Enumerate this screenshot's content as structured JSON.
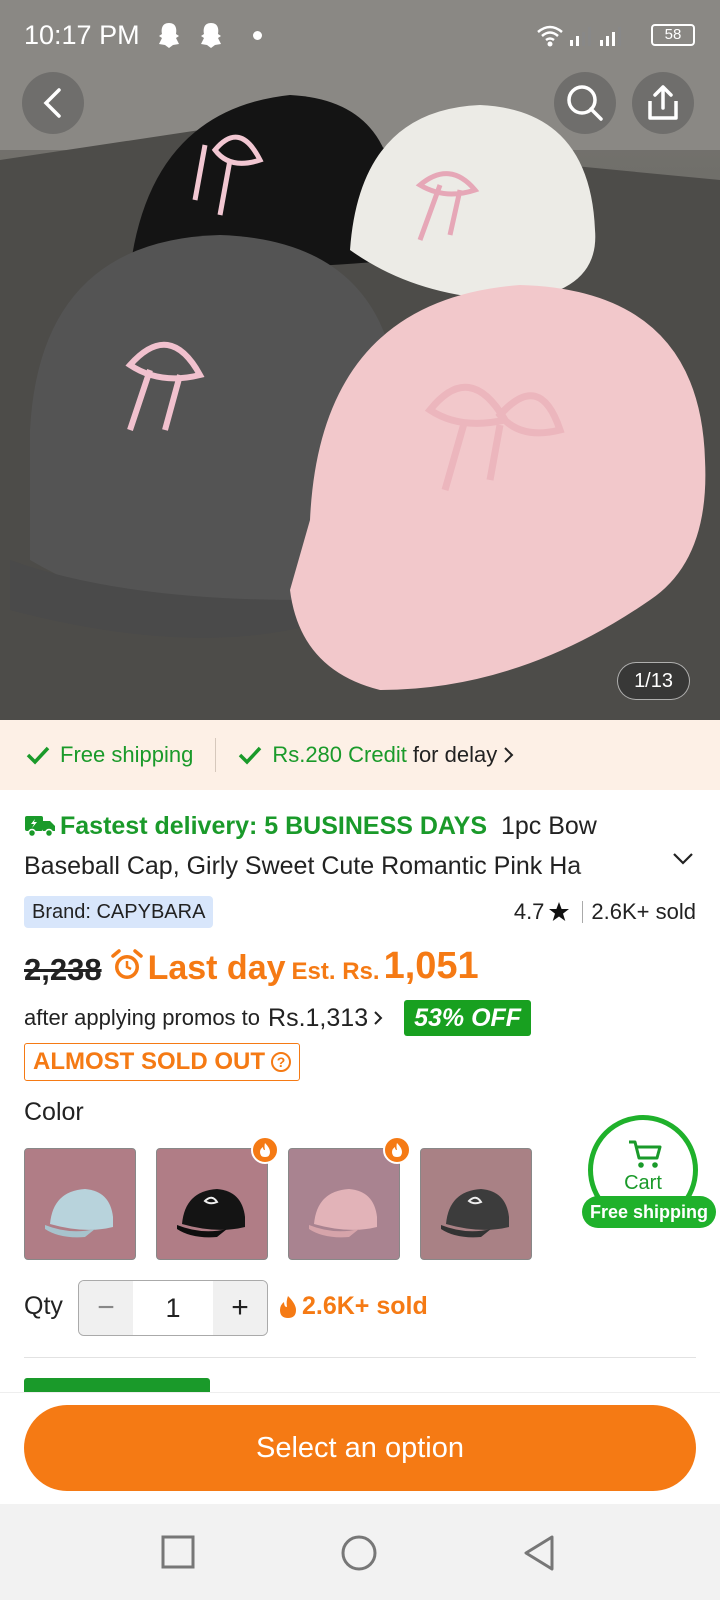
{
  "status_bar": {
    "time": "10:17 PM",
    "battery": "58",
    "icons": [
      "snapchat-icon",
      "snapchat-icon",
      "wifi-icon",
      "signal-icon",
      "signal-icon",
      "battery-icon"
    ]
  },
  "gallery": {
    "counter": "1/13",
    "back_icon": "chevron-left-icon",
    "search_icon": "search-icon",
    "share_icon": "share-icon"
  },
  "shipping_strip": {
    "free_shipping": "Free shipping",
    "credit": "Rs.280 Credit",
    "delay": "for delay"
  },
  "product": {
    "fast_delivery": "Fastest delivery: 5 BUSINESS DAYS",
    "title": "1pc Bow Baseball Cap, Girly Sweet Cute Romantic Pink Ha",
    "brand": "Brand: CAPYBARA",
    "rating": "4.7",
    "sold": "2.6K+ sold",
    "old_price": "2,238",
    "last_day": "Last day",
    "est": "Est. Rs.",
    "price": "1,051",
    "promo_text": "after applying promos to",
    "promo_price": "Rs.1,313",
    "discount": "53% OFF",
    "almost_sold_out": "ALMOST SOLD OUT",
    "help_glyph": "?"
  },
  "color": {
    "label": "Color",
    "options": [
      "light-blue",
      "black",
      "pink",
      "dark-gray"
    ]
  },
  "cart": {
    "label": "Cart",
    "free_shipping": "Free shipping"
  },
  "quantity": {
    "label": "Qty",
    "value": "1",
    "minus": "−",
    "plus": "+",
    "sold": "2.6K+ sold"
  },
  "cta": {
    "label": "Select an option"
  },
  "colors": {
    "accent": "#f57a14",
    "green": "#1a9a2a"
  }
}
